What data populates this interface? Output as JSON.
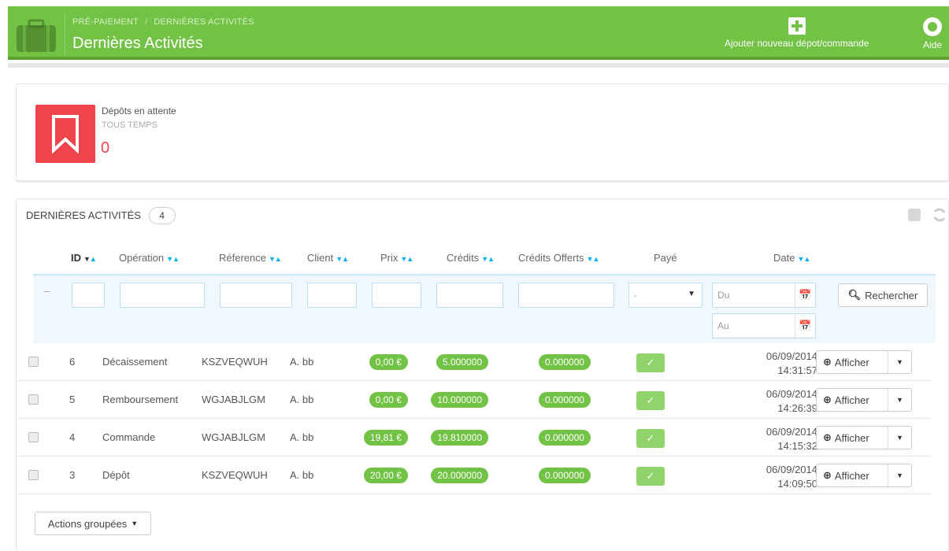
{
  "header": {
    "breadcrumb": [
      "PRÉ-PAIEMENT",
      "DERNIÈRES ACTIVITÉS"
    ],
    "title": "Dernières Activités",
    "actions": {
      "add_label": "Ajouter nouveau dépot/commande",
      "help_label": "Aide"
    },
    "accent": "#72c245"
  },
  "kpi": {
    "title": "Dépôts en attente",
    "subtitle": "TOUS TEMPS",
    "value": "0",
    "icon": "bookmark-icon",
    "color": "#f0444b"
  },
  "list": {
    "title": "DERNIÈRES ACTIVITÉS",
    "count": "4",
    "columns": [
      "ID",
      "Opération",
      "Réference",
      "Client",
      "Prix",
      "Crédits",
      "Crédits Offerts",
      "Payé",
      "Date"
    ],
    "filter": {
      "reset": "–",
      "paid_select": "-",
      "date_from_placeholder": "Du",
      "date_to_placeholder": "Au",
      "search_label": "Rechercher"
    },
    "rows": [
      {
        "id": "6",
        "operation": "Décaissement",
        "reference": "KSZVEQWUH",
        "client": "A. bb",
        "price": "0,00 €",
        "credits": "5.000000",
        "credits_offered": "0.000000",
        "paid": "✓",
        "date": "06/09/2014",
        "time": "14:31:57",
        "action": "Afficher"
      },
      {
        "id": "5",
        "operation": "Remboursement",
        "reference": "WGJABJLGM",
        "client": "A. bb",
        "price": "0,00 €",
        "credits": "10.000000",
        "credits_offered": "0.000000",
        "paid": "✓",
        "date": "06/09/2014",
        "time": "14:26:39",
        "action": "Afficher"
      },
      {
        "id": "4",
        "operation": "Commande",
        "reference": "WGJABJLGM",
        "client": "A. bb",
        "price": "19,81 €",
        "credits": "19.810000",
        "credits_offered": "0.000000",
        "paid": "✓",
        "date": "06/09/2014",
        "time": "14:15:32",
        "action": "Afficher"
      },
      {
        "id": "3",
        "operation": "Dépôt",
        "reference": "KSZVEQWUH",
        "client": "A. bb",
        "price": "20,00 €",
        "credits": "20.000000",
        "credits_offered": "0.000000",
        "paid": "✓",
        "date": "06/09/2014",
        "time": "14:09:50",
        "action": "Afficher"
      }
    ],
    "bulk_actions": "Actions groupées"
  }
}
